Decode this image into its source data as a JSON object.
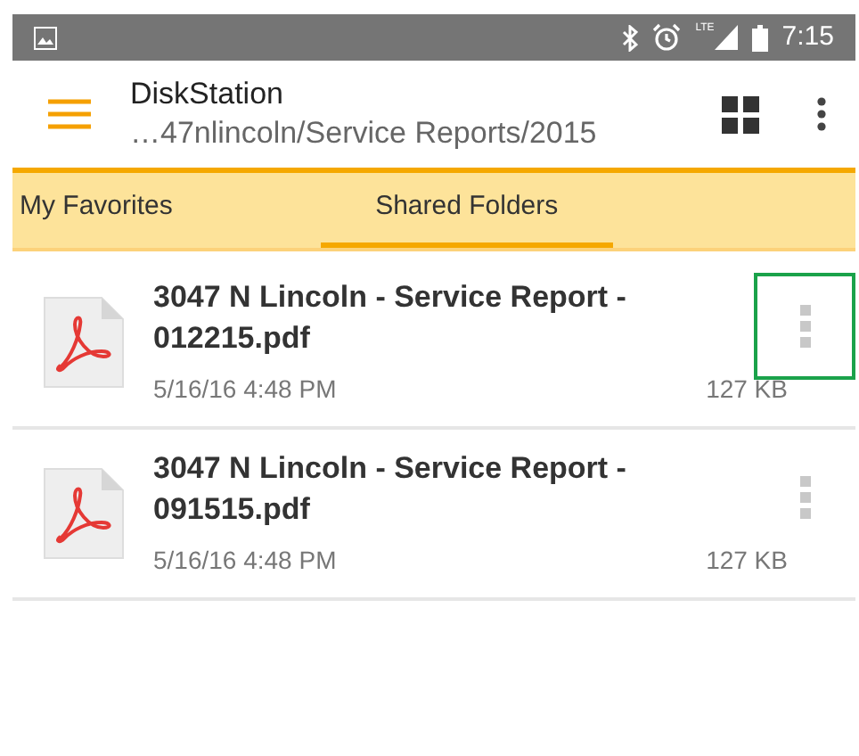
{
  "status_bar": {
    "time": "7:15",
    "network": "LTE"
  },
  "toolbar": {
    "title": "DiskStation",
    "subtitle": "…47nlincoln/Service Reports/2015"
  },
  "tabs": [
    {
      "label": "My Favorites",
      "selected": false
    },
    {
      "label": "Shared Folders",
      "selected": true
    }
  ],
  "files": [
    {
      "name": "3047 N Lincoln - Service Report - 012215.pdf",
      "date": "5/16/16 4:48 PM",
      "size": "127 KB",
      "focused": true
    },
    {
      "name": "3047 N Lincoln - Service Report - 091515.pdf",
      "date": "5/16/16 4:48 PM",
      "size": "127 KB",
      "focused": false
    }
  ]
}
